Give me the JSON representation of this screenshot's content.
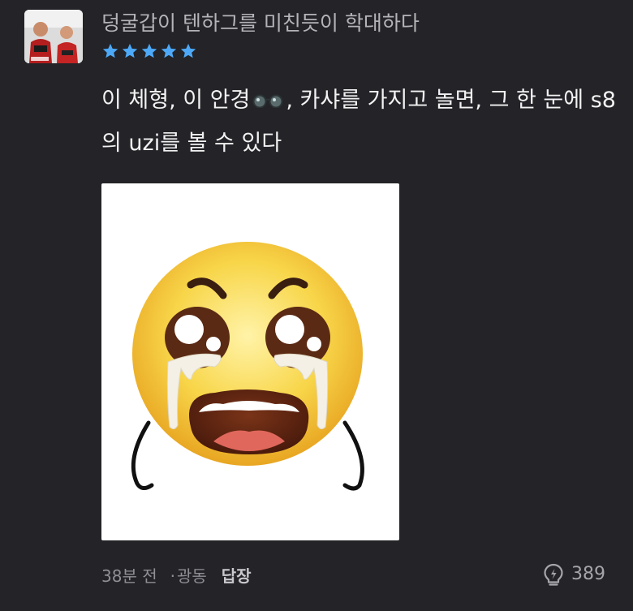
{
  "comment": {
    "username": "덩굴갑이 텐하그를 미친듯이 학대하다",
    "rating": 5,
    "text_before_emoji": "이 체형, 이 안경",
    "emoji_icon": "glasses-emoji",
    "text_after_emoji": ", 카샤를 가지고 놀면, 그 한 눈에 s8의 uzi를 볼 수 있다",
    "sticker_icon": "crying-angry-face-sticker",
    "time": "38분 전",
    "separator": "·",
    "location": "광동",
    "reply_label": "답장",
    "like_count": "389",
    "like_icon": "lightbulb-icon"
  },
  "colors": {
    "background": "#232328",
    "star": "#4da9f7",
    "username": "#b4b4b8",
    "text": "#f2f2f2",
    "meta": "#8f8f95"
  }
}
